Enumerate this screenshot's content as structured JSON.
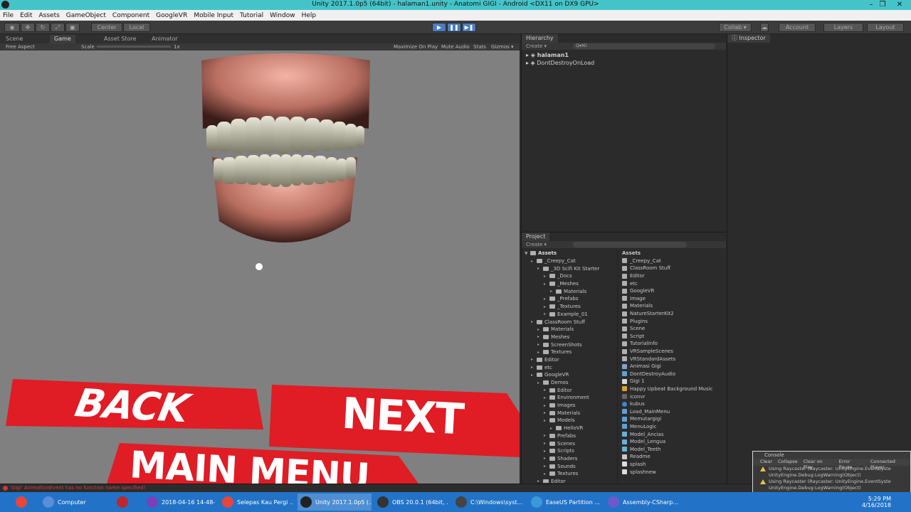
{
  "window": {
    "title": "Unity 2017.1.0p5 (64bit) - halaman1.unity - Anatomi GIGI - Android <DX11 on DX9 GPU>",
    "minimize": "–",
    "maximize": "❐",
    "close": "✕"
  },
  "menu": [
    "File",
    "Edit",
    "Assets",
    "GameObject",
    "Component",
    "GoogleVR",
    "Mobile Input",
    "Tutorial",
    "Window",
    "Help"
  ],
  "toolbar": {
    "pivot_center": "Center",
    "pivot_local": "Local",
    "collab": "Collab ▾",
    "account": "Account",
    "layers": "Layers",
    "layout": "Layout"
  },
  "view_tabs": {
    "scene": "Scene",
    "game": "Game",
    "asset_store": "Asset Store",
    "animator": "Animator"
  },
  "game_bar": {
    "aspect": "Free Aspect",
    "scale": "Scale",
    "scale_value": "1x",
    "maximize": "Maximize On Play",
    "mute": "Mute Audio",
    "stats": "Stats",
    "gizmos": "Gizmos ▾"
  },
  "game_view": {
    "back": "BACK",
    "next": "NEXT",
    "main_menu": "MAIN MENU"
  },
  "hierarchy": {
    "tab": "Hierarchy",
    "create": "Create ▾",
    "search": "Q▾All",
    "items": [
      "halaman1",
      "DontDestroyOnLoad"
    ]
  },
  "inspector": {
    "tab": "Inspector"
  },
  "project": {
    "tab": "Project",
    "create": "Create ▾",
    "tree_root": "Assets",
    "tree": [
      {
        "label": "_Creepy_Cat",
        "depth": 1
      },
      {
        "label": "_3D Scifi Kit Starter",
        "depth": 2
      },
      {
        "label": "_Docs",
        "depth": 3
      },
      {
        "label": "_Meshes",
        "depth": 3
      },
      {
        "label": "Materials",
        "depth": 4
      },
      {
        "label": "_Prefabs",
        "depth": 3
      },
      {
        "label": "_Textures",
        "depth": 3
      },
      {
        "label": "Example_01",
        "depth": 3
      },
      {
        "label": "ClassRoom Stuff",
        "depth": 1
      },
      {
        "label": "Materials",
        "depth": 2
      },
      {
        "label": "Meshes",
        "depth": 2
      },
      {
        "label": "ScreenShots",
        "depth": 2
      },
      {
        "label": "Textures",
        "depth": 2
      },
      {
        "label": "Editor",
        "depth": 1
      },
      {
        "label": "etc",
        "depth": 1
      },
      {
        "label": "GoogleVR",
        "depth": 1
      },
      {
        "label": "Demos",
        "depth": 2
      },
      {
        "label": "Editor",
        "depth": 3
      },
      {
        "label": "Environment",
        "depth": 3
      },
      {
        "label": "Images",
        "depth": 3
      },
      {
        "label": "Materials",
        "depth": 3
      },
      {
        "label": "Models",
        "depth": 3
      },
      {
        "label": "HelloVR",
        "depth": 4
      },
      {
        "label": "Prefabs",
        "depth": 3
      },
      {
        "label": "Scenes",
        "depth": 3
      },
      {
        "label": "Scripts",
        "depth": 3
      },
      {
        "label": "Shaders",
        "depth": 3
      },
      {
        "label": "Sounds",
        "depth": 3
      },
      {
        "label": "Textures",
        "depth": 3
      },
      {
        "label": "Editor",
        "depth": 2
      }
    ],
    "assets_header": "Assets",
    "files": [
      {
        "label": "_Creepy_Cat",
        "kind": "folder"
      },
      {
        "label": "ClassRoom Stuff",
        "kind": "folder"
      },
      {
        "label": "Editor",
        "kind": "folder"
      },
      {
        "label": "etc",
        "kind": "folder"
      },
      {
        "label": "GoogleVR",
        "kind": "folder"
      },
      {
        "label": "Image",
        "kind": "folder"
      },
      {
        "label": "Materials",
        "kind": "folder"
      },
      {
        "label": "NatureStarterKit2",
        "kind": "folder"
      },
      {
        "label": "Plugins",
        "kind": "folder"
      },
      {
        "label": "Scene",
        "kind": "folder"
      },
      {
        "label": "Script",
        "kind": "folder"
      },
      {
        "label": "TutorialInfo",
        "kind": "folder"
      },
      {
        "label": "VRSampleScenes",
        "kind": "folder"
      },
      {
        "label": "VRStandardAssets",
        "kind": "folder"
      },
      {
        "label": "Animasi Gigi",
        "kind": "anim"
      },
      {
        "label": "DontDestroyAudio",
        "kind": "script"
      },
      {
        "label": "Gigi 1",
        "kind": "scene"
      },
      {
        "label": "Happy Upbeat Background Music",
        "kind": "audio"
      },
      {
        "label": "iconvr",
        "kind": "image"
      },
      {
        "label": "kubus",
        "kind": "sphere"
      },
      {
        "label": "Load_MainMenu",
        "kind": "script"
      },
      {
        "label": "Memutargigi",
        "kind": "script"
      },
      {
        "label": "MenuLogic",
        "kind": "script"
      },
      {
        "label": "Model_Ancias",
        "kind": "model"
      },
      {
        "label": "Model_Lengua",
        "kind": "model"
      },
      {
        "label": "Model_Teeth",
        "kind": "model"
      },
      {
        "label": "Readme",
        "kind": "doc"
      },
      {
        "label": "splash",
        "kind": "image2"
      },
      {
        "label": "splashnew",
        "kind": "image2"
      }
    ]
  },
  "console": {
    "tab": "Console",
    "buttons": [
      "Clear",
      "Collapse",
      "Clear on Play",
      "Error Pause",
      "Connected Player"
    ],
    "lines": [
      "Using Raycaster (Raycaster: UnityEngine.EventSyste",
      "UnityEngine.Debug:LogWarning(Object)",
      "Using Raycaster (Raycaster: UnityEngine.EventSyste",
      "UnityEngine.Debug:LogWarning(Object)"
    ]
  },
  "status_bar": {
    "message": "'Gigi' AnimationEvent has no function name specified!"
  },
  "taskbar": {
    "items": [
      {
        "label": "",
        "color": "#e8453c"
      },
      {
        "label": "Computer",
        "color": "#5a8fd8"
      },
      {
        "label": "",
        "color": "#c0262c"
      },
      {
        "label": "2018-04-16 14-48-...",
        "color": "#7b3fb8"
      },
      {
        "label": "Selepas Kau Pergi ...",
        "color": "#e8453c"
      },
      {
        "label": "Unity 2017.1.0p5 (...",
        "color": "#222222"
      },
      {
        "label": "OBS 20.0.1 (64bit, ...",
        "color": "#333333"
      },
      {
        "label": "C:\\Windows\\syst...",
        "color": "#444444"
      },
      {
        "label": "EaseUS Partition ...",
        "color": "#3a9ad9"
      },
      {
        "label": "Assembly-CSharp...",
        "color": "#6a5acd"
      }
    ],
    "time": "5:29 PM",
    "date": "4/16/2018"
  },
  "colors": {
    "title_bar": "#44c4c8",
    "button_red": "#e01c24",
    "taskbar": "#2273c8",
    "viewport": "#808080"
  }
}
